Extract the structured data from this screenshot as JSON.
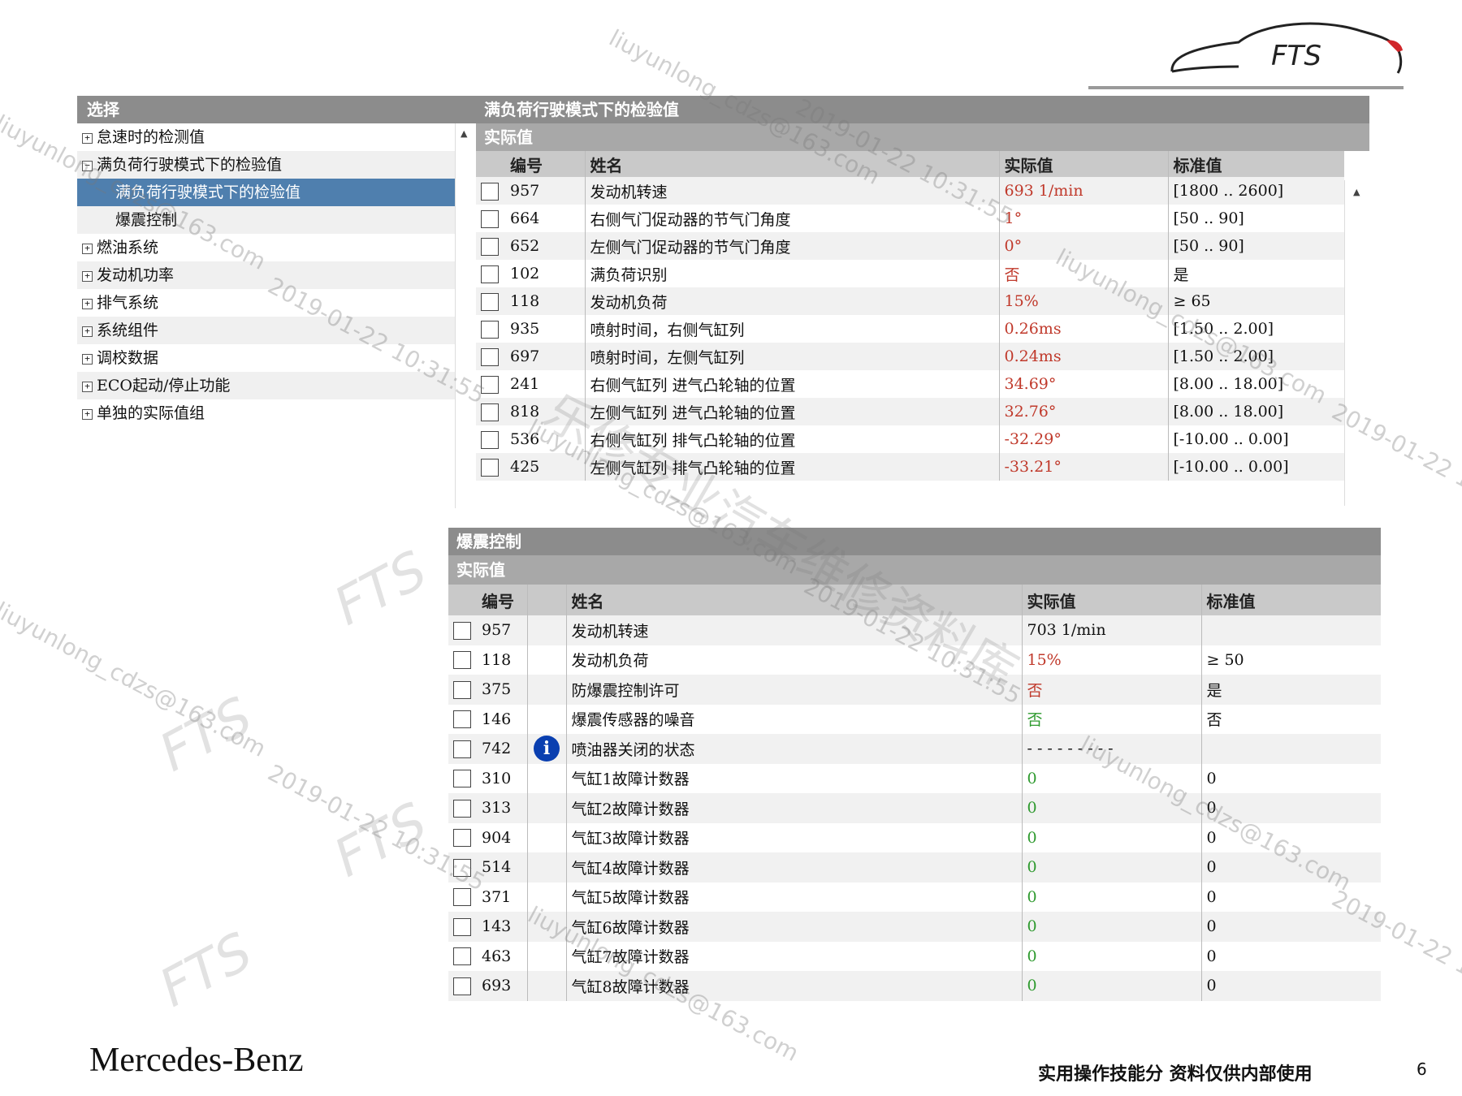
{
  "logo": {
    "text": "FTS"
  },
  "tree": {
    "header": "选择",
    "items": [
      {
        "label": "怠速时的检测值",
        "type": "parent",
        "expand": "+"
      },
      {
        "label": "满负荷行驶模式下的检验值",
        "type": "parent",
        "expand": "−"
      },
      {
        "label": "满负荷行驶模式下的检验值",
        "type": "child",
        "selected": true
      },
      {
        "label": "爆震控制",
        "type": "child"
      },
      {
        "label": "燃油系统",
        "type": "parent",
        "expand": "+"
      },
      {
        "label": "发动机功率",
        "type": "parent",
        "expand": "+"
      },
      {
        "label": "排气系统",
        "type": "parent",
        "expand": "+"
      },
      {
        "label": "系统组件",
        "type": "parent",
        "expand": "+"
      },
      {
        "label": "调校数据",
        "type": "parent",
        "expand": "+"
      },
      {
        "label": "ECO起动/停止功能",
        "type": "parent",
        "expand": "+"
      },
      {
        "label": "单独的实际值组",
        "type": "parent",
        "expand": "+"
      }
    ]
  },
  "panel1": {
    "title": "满负荷行驶模式下的检验值",
    "subtitle": "实际值",
    "columns": {
      "id": "编号",
      "name": "姓名",
      "actual": "实际值",
      "standard": "标准值"
    },
    "rows": [
      {
        "id": "957",
        "name": "发动机转速",
        "actual": "693 1/min",
        "actual_color": "red",
        "standard": "[1800 .. 2600]"
      },
      {
        "id": "664",
        "name": "右侧气门促动器的节气门角度",
        "actual": "1°",
        "actual_color": "red",
        "standard": "[50 .. 90]"
      },
      {
        "id": "652",
        "name": "左侧气门促动器的节气门角度",
        "actual": "0°",
        "actual_color": "red",
        "standard": "[50 .. 90]"
      },
      {
        "id": "102",
        "name": "满负荷识别",
        "actual": "否",
        "actual_color": "red",
        "standard": "是"
      },
      {
        "id": "118",
        "name": "发动机负荷",
        "actual": "15%",
        "actual_color": "red",
        "standard": "≥ 65"
      },
      {
        "id": "935",
        "name": "喷射时间，右侧气缸列",
        "actual": "0.26ms",
        "actual_color": "red",
        "standard": "[1.50 .. 2.00]"
      },
      {
        "id": "697",
        "name": "喷射时间，左侧气缸列",
        "actual": "0.24ms",
        "actual_color": "red",
        "standard": "[1.50 .. 2.00]"
      },
      {
        "id": "241",
        "name": "右侧气缸列 进气凸轮轴的位置",
        "actual": "34.69°",
        "actual_color": "red",
        "standard": "[8.00 .. 18.00]"
      },
      {
        "id": "818",
        "name": "左侧气缸列 进气凸轮轴的位置",
        "actual": "32.76°",
        "actual_color": "red",
        "standard": "[8.00 .. 18.00]"
      },
      {
        "id": "536",
        "name": "右侧气缸列 排气凸轮轴的位置",
        "actual": "-32.29°",
        "actual_color": "red",
        "standard": "[-10.00 .. 0.00]"
      },
      {
        "id": "425",
        "name": "左侧气缸列 排气凸轮轴的位置",
        "actual": "-33.21°",
        "actual_color": "red",
        "standard": "[-10.00 .. 0.00]"
      }
    ]
  },
  "panel2": {
    "title": "爆震控制",
    "subtitle": "实际值",
    "columns": {
      "id": "编号",
      "name": "姓名",
      "actual": "实际值",
      "standard": "标准值"
    },
    "rows": [
      {
        "id": "957",
        "name": "发动机转速",
        "actual": "703 1/min",
        "actual_color": "black",
        "standard": ""
      },
      {
        "id": "118",
        "name": "发动机负荷",
        "actual": "15%",
        "actual_color": "red",
        "standard": "≥ 50"
      },
      {
        "id": "375",
        "name": "防爆震控制许可",
        "actual": "否",
        "actual_color": "red",
        "standard": "是"
      },
      {
        "id": "146",
        "name": "爆震传感器的噪音",
        "actual": "否",
        "actual_color": "green",
        "standard": "否"
      },
      {
        "id": "742",
        "name": "喷油器关闭的状态",
        "actual": "- - - - - - - - -",
        "actual_color": "black",
        "standard": "",
        "info": true
      },
      {
        "id": "310",
        "name": "气缸1故障计数器",
        "actual": "0",
        "actual_color": "green",
        "standard": "0"
      },
      {
        "id": "313",
        "name": "气缸2故障计数器",
        "actual": "0",
        "actual_color": "green",
        "standard": "0"
      },
      {
        "id": "904",
        "name": "气缸3故障计数器",
        "actual": "0",
        "actual_color": "green",
        "standard": "0"
      },
      {
        "id": "514",
        "name": "气缸4故障计数器",
        "actual": "0",
        "actual_color": "green",
        "standard": "0"
      },
      {
        "id": "371",
        "name": "气缸5故障计数器",
        "actual": "0",
        "actual_color": "green",
        "standard": "0"
      },
      {
        "id": "143",
        "name": "气缸6故障计数器",
        "actual": "0",
        "actual_color": "green",
        "standard": "0"
      },
      {
        "id": "463",
        "name": "气缸7故障计数器",
        "actual": "0",
        "actual_color": "green",
        "standard": "0"
      },
      {
        "id": "693",
        "name": "气缸8故障计数器",
        "actual": "0",
        "actual_color": "green",
        "standard": "0"
      }
    ]
  },
  "watermarks": {
    "email": "liuyunlong_cdzs@163.com",
    "date": "2019-01-22 10:31:55",
    "shop": "乐修专业汽车维修资料库",
    "fts": "FTS"
  },
  "footer": {
    "brand": "Mercedes-Benz",
    "note": "实用操作技能分 资料仅供内部使用",
    "page": "6"
  },
  "colors": {
    "header_gray": "#8c8c8c",
    "selected_blue": "#4f7fae",
    "value_red": "#c0392b",
    "value_green": "#2e9a2e",
    "info_blue": "#0a3fb0"
  }
}
